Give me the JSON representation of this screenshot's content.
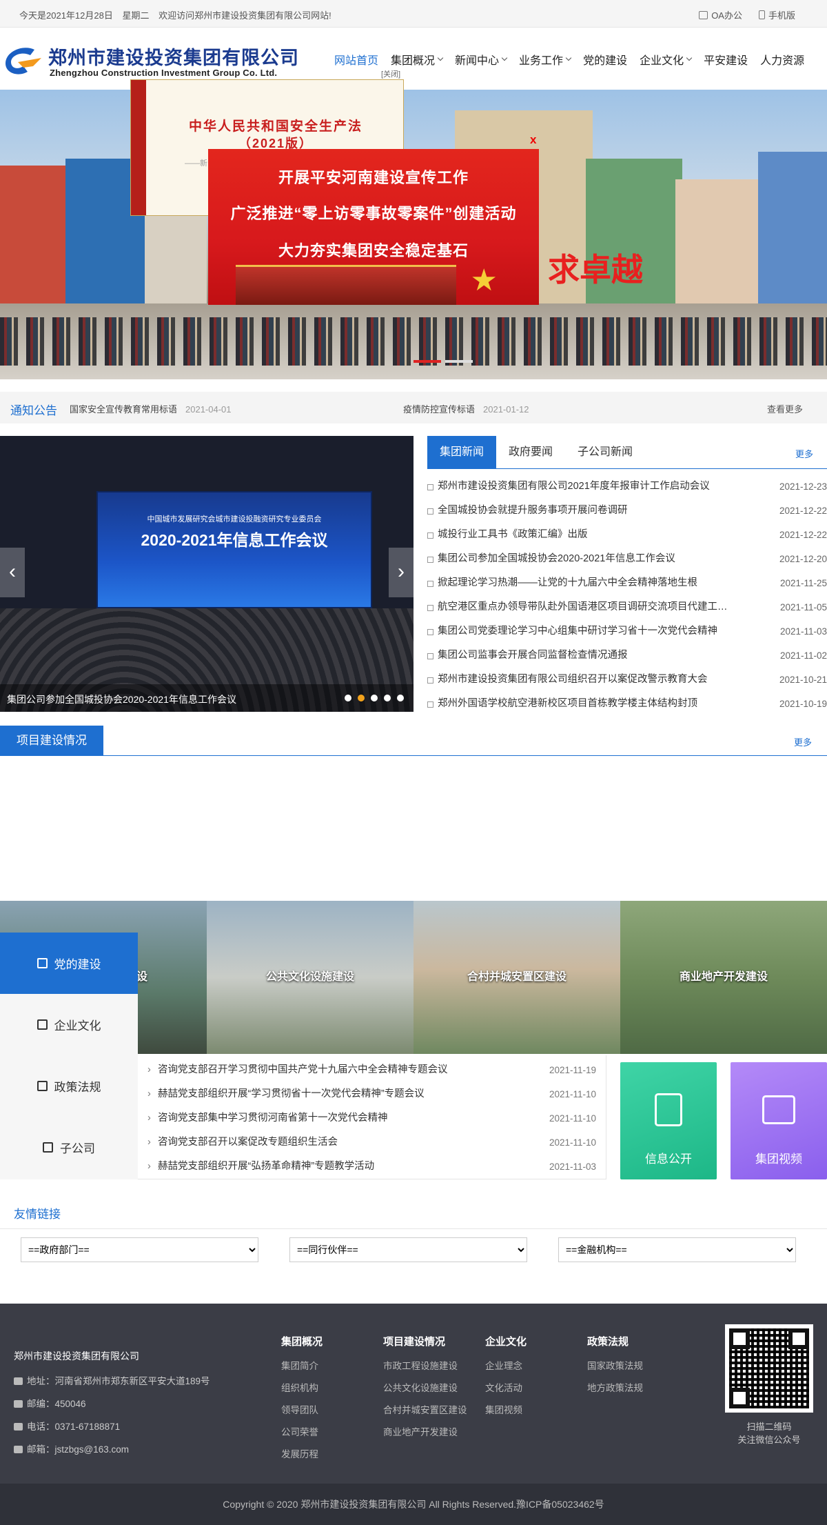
{
  "topbar": {
    "date_text": "今天是2021年12月28日",
    "weekday": "星期二",
    "welcome": "欢迎访问郑州市建设投资集团有限公司网站!",
    "oa_label": "OA办公",
    "mobile_label": "手机版"
  },
  "header": {
    "company_cn": "郑州市建设投资集团有限公司",
    "company_en": "Zhengzhou Construction Investment Group Co. Ltd.",
    "nav": [
      {
        "label": "网站首页"
      },
      {
        "label": "集团概况"
      },
      {
        "label": "新闻中心"
      },
      {
        "label": "业务工作"
      },
      {
        "label": "党的建设"
      },
      {
        "label": "企业文化"
      },
      {
        "label": "平安建设"
      },
      {
        "label": "人力资源"
      }
    ],
    "close_tag": "[关闭]"
  },
  "banner": {
    "slogan_fragment": "求卓越"
  },
  "popup1": {
    "line1": "中华人民共和国安全生产法",
    "line2": "（2021版）",
    "line3": "——新"
  },
  "popup2": {
    "line1": "开展平安河南建设宣传工作",
    "line2": "广泛推进“零上访零事故零案件”创建活动",
    "line3": "大力夯实集团安全稳定基石",
    "close": "x"
  },
  "notice": {
    "label": "通知公告",
    "items": [
      {
        "title": "国家安全宣传教育常用标语",
        "date": "2021-04-01"
      },
      {
        "title": "疫情防控宣传标语",
        "date": "2021-01-12"
      }
    ],
    "more": "查看更多"
  },
  "slider": {
    "screen_line1": "中国城市发展研究会城市建设投融资研究专业委员会",
    "screen_line2": "2020-2021年信息工作会议",
    "caption": "集团公司参加全国城投协会2020-2021年信息工作会议",
    "prev": "‹",
    "next": "›"
  },
  "news": {
    "tabs": [
      "集团新闻",
      "政府要闻",
      "子公司新闻"
    ],
    "more": "更多",
    "items": [
      {
        "title": "郑州市建设投资集团有限公司2021年度年报审计工作启动会议",
        "date": "2021-12-23"
      },
      {
        "title": "全国城投协会就提升服务事项开展问卷调研",
        "date": "2021-12-22"
      },
      {
        "title": "城投行业工具书《政策汇编》出版",
        "date": "2021-12-22"
      },
      {
        "title": "集团公司参加全国城投协会2020-2021年信息工作会议",
        "date": "2021-12-20"
      },
      {
        "title": "掀起理论学习热潮——让党的十九届六中全会精神落地生根",
        "date": "2021-11-25"
      },
      {
        "title": "航空港区重点办领导带队赴外国语港区项目调研交流项目代建工…",
        "date": "2021-11-05"
      },
      {
        "title": "集团公司党委理论学习中心组集中研讨学习省十一次党代会精神",
        "date": "2021-11-03"
      },
      {
        "title": "集团公司监事会开展合同监督检查情况通报",
        "date": "2021-11-02"
      },
      {
        "title": "郑州市建设投资集团有限公司组织召开以案促改警示教育大会",
        "date": "2021-10-21"
      },
      {
        "title": "郑州外国语学校航空港新校区项目首栋教学楼主体结构封顶",
        "date": "2021-10-19"
      }
    ]
  },
  "projects": {
    "label": "项目建设情况",
    "more": "更多",
    "strip": [
      "市政工程设施建设",
      "公共文化设施建设",
      "合村并城安置区建设",
      "商业地产开发建设"
    ]
  },
  "leftmenu": [
    {
      "label": "党的建设",
      "icon": "hammer-sickle-icon"
    },
    {
      "label": "企业文化",
      "icon": "clipboard-icon"
    },
    {
      "label": "政策法规",
      "icon": "book-icon"
    },
    {
      "label": "子公司",
      "icon": "layers-icon"
    }
  ],
  "party_news": [
    {
      "title": "咨询党支部召开学习贯彻中国共产党十九届六中全会精神专题会议",
      "date": "2021-11-19"
    },
    {
      "title": "赫喆党支部组织开展“学习贯彻省十一次党代会精神”专题会议",
      "date": "2021-11-10"
    },
    {
      "title": "咨询党支部集中学习贯彻河南省第十一次党代会精神",
      "date": "2021-11-10"
    },
    {
      "title": "咨询党支部召开以案促改专题组织生活会",
      "date": "2021-11-10"
    },
    {
      "title": "赫喆党支部组织开展“弘扬革命精神”专题教学活动",
      "date": "2021-11-03"
    }
  ],
  "cards": {
    "info_public": "信息公开",
    "group_video": "集团视频"
  },
  "friends": {
    "label": "友情链接",
    "selects": [
      "==政府部门==",
      "==同行伙伴==",
      "==金融机构=="
    ]
  },
  "footer": {
    "company": "郑州市建设投资集团有限公司",
    "address": "地址：河南省郑州市郑东新区平安大道189号",
    "zip": "邮编：450046",
    "phone": "电话：0371-67188871",
    "email": "邮箱：jstzbgs@163.com",
    "columns": [
      {
        "title": "集团概况",
        "links": [
          "集团简介",
          "组织机构",
          "领导团队",
          "公司荣誉",
          "发展历程"
        ]
      },
      {
        "title": "项目建设情况",
        "links": [
          "市政工程设施建设",
          "公共文化设施建设",
          "合村并城安置区建设",
          "商业地产开发建设"
        ]
      },
      {
        "title": "企业文化",
        "links": [
          "企业理念",
          "文化活动",
          "集团视频"
        ]
      },
      {
        "title": "政策法规",
        "links": [
          "国家政策法规",
          "地方政策法规"
        ]
      }
    ],
    "qr_line1": "扫描二维码",
    "qr_line2": "关注微信公众号"
  },
  "copyright": "Copyright © 2020 郑州市建设投资集团有限公司 All Rights Reserved.豫ICP备05023462号",
  "colors": {
    "accent": "#1e6fd0",
    "footer": "#3b3d46"
  }
}
